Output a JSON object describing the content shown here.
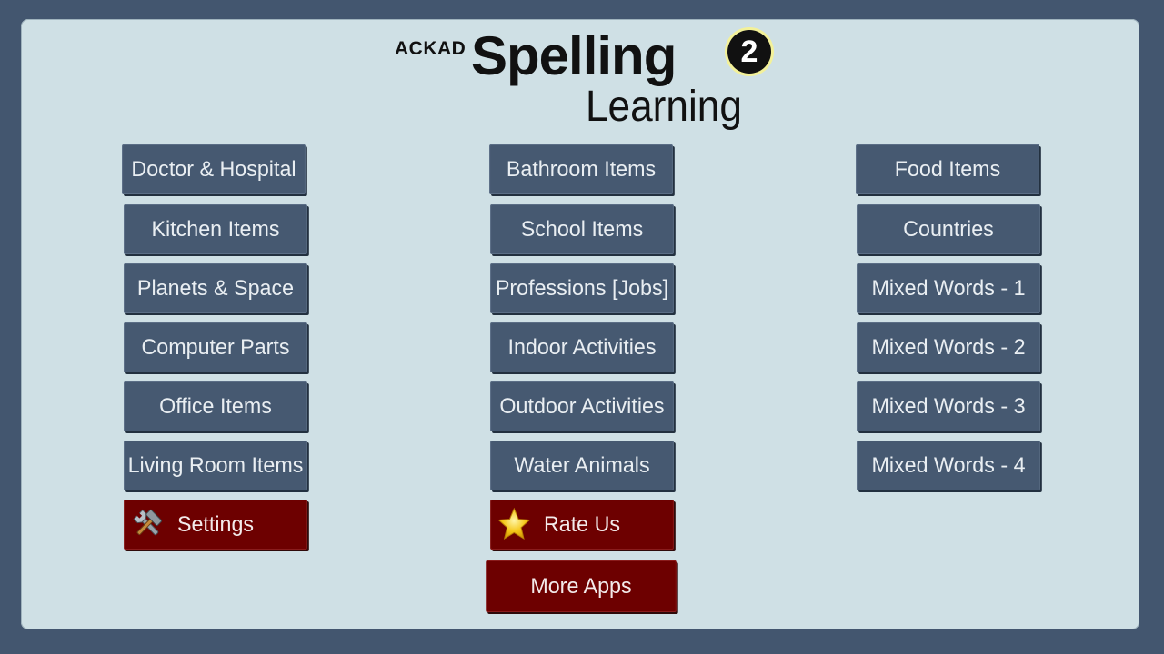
{
  "logo": {
    "ackad": "ACKAD",
    "spelling": "Spelling",
    "learning": "Learning",
    "badge": "2"
  },
  "columns": {
    "left": [
      "Doctor & Hospital",
      "Kitchen Items",
      "Planets & Space",
      "Computer Parts",
      "Office Items",
      "Living Room Items"
    ],
    "middle": [
      "Bathroom Items",
      "School Items",
      "Professions [Jobs]",
      "Indoor Activities",
      "Outdoor Activities",
      "Water Animals"
    ],
    "right": [
      "Food Items",
      "Countries",
      "Mixed Words - 1",
      "Mixed Words - 2",
      "Mixed Words - 3",
      "Mixed Words - 4"
    ]
  },
  "actions": {
    "settings": "Settings",
    "rate_us": "Rate Us",
    "more_apps": "More Apps"
  },
  "icons": {
    "settings": "tools-icon",
    "rate_us": "star-icon"
  },
  "colors": {
    "background": "#43566f",
    "panel": "#cfe0e5",
    "category_button": "#465971",
    "action_button": "#6d0000"
  }
}
